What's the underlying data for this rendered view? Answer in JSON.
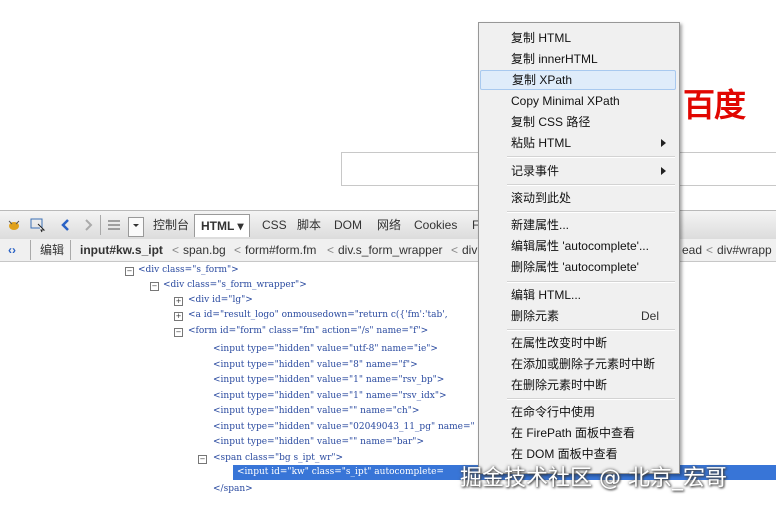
{
  "page": {
    "logo_text": "百度"
  },
  "toolbar": {
    "items": [
      {
        "label": "控制台"
      },
      {
        "label": "HTML ▾"
      },
      {
        "label": "CSS"
      },
      {
        "label": "脚本"
      },
      {
        "label": "DOM"
      },
      {
        "label": "网络"
      },
      {
        "label": "Cookies"
      },
      {
        "label": "F"
      }
    ]
  },
  "breadcrumb": {
    "edit_label": "编辑",
    "current": "input#kw.s_ipt",
    "items": [
      "span.bg",
      "form#form.fm",
      "div.s_form_wrapper",
      "div"
    ],
    "right_items": [
      "ead",
      "div#wrapp"
    ],
    "sep": "<"
  },
  "tree": {
    "rows": [
      {
        "text": "<div class=\"s_form\">"
      },
      {
        "text": "<div class=\"s_form_wrapper\">"
      },
      {
        "text": "<div id=\"lg\">"
      },
      {
        "text": "<a id=\"result_logo\" onmousedown=\"return c({'fm':'tab',"
      },
      {
        "text": "<form id=\"form\" class=\"fm\" action=\"/s\" name=\"f\">"
      },
      {
        "text": "<input type=\"hidden\" value=\"utf-8\" name=\"ie\">"
      },
      {
        "text": "<input type=\"hidden\" value=\"8\" name=\"f\">"
      },
      {
        "text": "<input type=\"hidden\" value=\"1\" name=\"rsv_bp\">"
      },
      {
        "text": "<input type=\"hidden\" value=\"1\" name=\"rsv_idx\">"
      },
      {
        "text": "<input type=\"hidden\" value=\"\" name=\"ch\">"
      },
      {
        "text": "<input type=\"hidden\" value=\"02049043_11_pg\" name=\""
      },
      {
        "text": "<input type=\"hidden\" value=\"\" name=\"bar\">"
      },
      {
        "text": "<span class=\"bg s_ipt_wr\">"
      },
      {
        "text": "<input id=\"kw\" class=\"s_ipt\" autocomplete="
      },
      {
        "text": "</span>"
      }
    ]
  },
  "context_menu": {
    "items": [
      {
        "label": "复制 HTML"
      },
      {
        "label": "复制 innerHTML"
      },
      {
        "label": "复制 XPath"
      },
      {
        "label": "Copy Minimal XPath"
      },
      {
        "label": "复制 CSS 路径"
      },
      {
        "label": "粘贴 HTML"
      },
      {
        "label": "记录事件"
      },
      {
        "label": "滚动到此处"
      },
      {
        "label": "新建属性..."
      },
      {
        "label": "编辑属性 'autocomplete'..."
      },
      {
        "label": "删除属性 'autocomplete'"
      },
      {
        "label": "编辑 HTML..."
      },
      {
        "label": "删除元素",
        "shortcut": "Del"
      },
      {
        "label": "在属性改变时中断"
      },
      {
        "label": "在添加或删除子元素时中断"
      },
      {
        "label": "在删除元素时中断"
      },
      {
        "label": "在命令行中使用"
      },
      {
        "label": "在 FirePath 面板中查看"
      },
      {
        "label": "在 DOM 面板中查看"
      }
    ]
  },
  "watermark": {
    "text": "掘金技术社区 @ 北京_宏哥"
  },
  "colors": {
    "logo_red": "#e10601",
    "selection_blue": "#3875d7",
    "menu_highlight": "#dfecfa"
  }
}
